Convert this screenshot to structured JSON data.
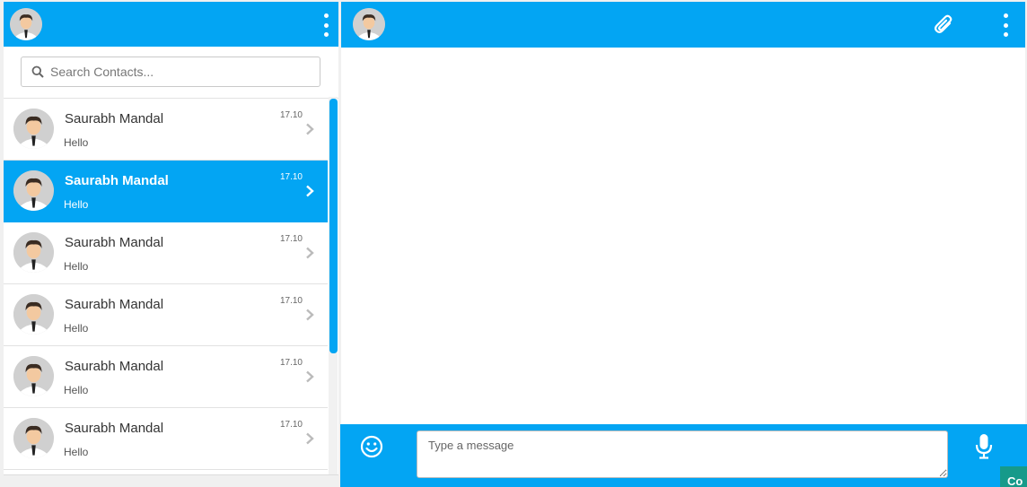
{
  "colors": {
    "accent": "#03a5f3",
    "corner_button": "#169a8a"
  },
  "left_header": {
    "avatar_icon": "user-avatar-icon",
    "menu_icon": "kebab-menu-icon"
  },
  "search": {
    "placeholder": "Search Contacts...",
    "value": "",
    "icon": "search-icon"
  },
  "contacts": [
    {
      "name": "Saurabh Mandal",
      "message": "Hello",
      "time": "17.10",
      "active": false
    },
    {
      "name": "Saurabh Mandal",
      "message": "Hello",
      "time": "17.10",
      "active": true
    },
    {
      "name": "Saurabh Mandal",
      "message": "Hello",
      "time": "17.10",
      "active": false
    },
    {
      "name": "Saurabh Mandal",
      "message": "Hello",
      "time": "17.10",
      "active": false
    },
    {
      "name": "Saurabh Mandal",
      "message": "Hello",
      "time": "17.10",
      "active": false
    },
    {
      "name": "Saurabh Mandal",
      "message": "Hello",
      "time": "17.10",
      "active": false
    }
  ],
  "chat_header": {
    "avatar_icon": "user-avatar-icon",
    "attach_icon": "paperclip-icon",
    "menu_icon": "kebab-menu-icon"
  },
  "composer": {
    "placeholder": "Type a message",
    "value": "",
    "emoji_icon": "smiley-icon",
    "mic_icon": "microphone-icon"
  },
  "corner_button": {
    "label": "Co"
  }
}
